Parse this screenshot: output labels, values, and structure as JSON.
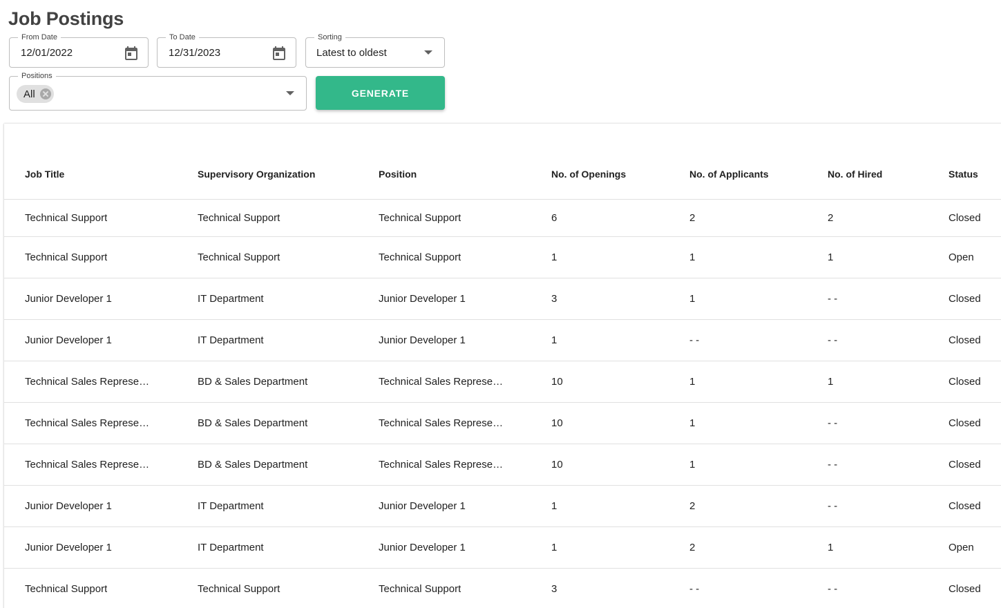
{
  "page": {
    "title": "Job Postings"
  },
  "filters": {
    "from_date": {
      "label": "From Date",
      "value": "12/01/2022"
    },
    "to_date": {
      "label": "To Date",
      "value": "12/31/2023"
    },
    "sorting": {
      "label": "Sorting",
      "value": "Latest to oldest"
    },
    "positions": {
      "label": "Positions",
      "chip": "All"
    },
    "generate_label": "GENERATE"
  },
  "colors": {
    "accent": "#33b88a",
    "border": "#bdbdbd",
    "divider": "#e0e0e0"
  },
  "table": {
    "headers": [
      "Job Title",
      "Supervisory Organization",
      "Position",
      "No. of Openings",
      "No. of Applicants",
      "No. of Hired",
      "Status"
    ],
    "rows": [
      [
        "Technical Support",
        "Technical Support",
        "Technical Support",
        "6",
        "2",
        "2",
        "Closed"
      ],
      [
        "Technical Support",
        "Technical Support",
        "Technical Support",
        "1",
        "1",
        "1",
        "Open"
      ],
      [
        "Junior Developer 1",
        "IT Department",
        "Junior Developer 1",
        "3",
        "1",
        "- -",
        "Closed"
      ],
      [
        "Junior Developer 1",
        "IT Department",
        "Junior Developer 1",
        "1",
        "- -",
        "- -",
        "Closed"
      ],
      [
        "Technical Sales Represe…",
        "BD & Sales Department",
        "Technical Sales Represe…",
        "10",
        "1",
        "1",
        "Closed"
      ],
      [
        "Technical Sales Represe…",
        "BD & Sales Department",
        "Technical Sales Represe…",
        "10",
        "1",
        "- -",
        "Closed"
      ],
      [
        "Technical Sales Represe…",
        "BD & Sales Department",
        "Technical Sales Represe…",
        "10",
        "1",
        "- -",
        "Closed"
      ],
      [
        "Junior Developer 1",
        "IT Department",
        "Junior Developer 1",
        "1",
        "2",
        "- -",
        "Closed"
      ],
      [
        "Junior Developer 1",
        "IT Department",
        "Junior Developer 1",
        "1",
        "2",
        "1",
        "Open"
      ],
      [
        "Technical Support",
        "Technical Support",
        "Technical Support",
        "3",
        "- -",
        "- -",
        "Closed"
      ]
    ]
  }
}
